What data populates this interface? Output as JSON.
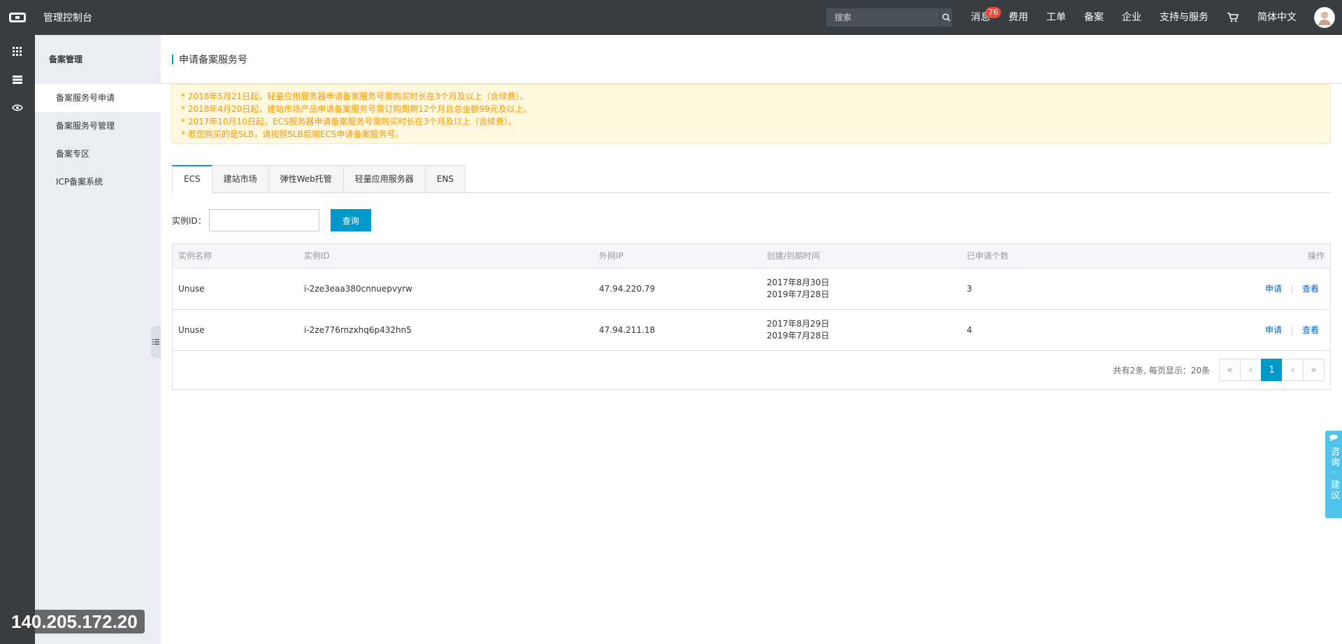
{
  "topbar": {
    "console_title": "管理控制台",
    "search_placeholder": "搜索",
    "messages_label": "消息",
    "messages_count": "76",
    "nav": [
      "费用",
      "工单",
      "备案",
      "企业",
      "支持与服务"
    ],
    "language": "简体中文"
  },
  "subnav": {
    "title": "备案管理",
    "items": [
      "备案服务号申请",
      "备案服务号管理",
      "备案专区",
      "ICP备案系统"
    ]
  },
  "overlay_ip": "140.205.172.20",
  "page": {
    "title": "申请备案服务号",
    "notices": [
      "* 2018年5月21日起，轻量应用服务器申请备案服务号需购买时长在3个月及以上（含续费）。",
      "* 2018年4月20日起，建站市场产品申请备案服务号需订购周期12个月且总金额99元及以上。",
      "* 2017年10月10日起，ECS服务器申请备案服务号需购买时长在3个月及以上（含续费）。",
      "* 若您购买的是SLB，请按照SLB后端ECS申请备案服务号。"
    ],
    "tabs": [
      "ECS",
      "建站市场",
      "弹性Web托管",
      "轻量应用服务器",
      "ENS"
    ],
    "query_label": "实例ID：",
    "query_value": "",
    "query_button": "查询"
  },
  "table": {
    "headers": [
      "实例名称",
      "实例ID",
      "外网IP",
      "创建/到期时间",
      "已申请个数",
      "操作"
    ],
    "rows": [
      {
        "name": "Unuse",
        "id": "i-2ze3eaa380cnnuepvyrw",
        "ip": "47.94.220.79",
        "created": "2017年8月30日",
        "expires": "2019年7月28日",
        "count": "3",
        "apply": "申请",
        "view": "查看"
      },
      {
        "name": "Unuse",
        "id": "i-2ze776rnzxhq6p432hn5",
        "ip": "47.94.211.18",
        "created": "2017年8月29日",
        "expires": "2019年7月28日",
        "count": "4",
        "apply": "申请",
        "view": "查看"
      }
    ]
  },
  "pager": {
    "summary": "共有2条, 每页显示：20条",
    "first": "«",
    "prev": "‹",
    "current": "1",
    "next": "›",
    "last": "»"
  },
  "feedback": {
    "label": "咨询·建议"
  },
  "icons": [
    "logo-icon",
    "search-icon",
    "cart-icon",
    "avatar",
    "grid-icon",
    "list-icon",
    "eye-icon",
    "collapse-icon",
    "feedback-icon"
  ],
  "colors": {
    "topbar": "#373d41",
    "accent": "#0099cc",
    "notice_text": "#f39800",
    "notice_bg": "#fff8de",
    "badge": "#e74c3c",
    "link": "#0066cc"
  }
}
